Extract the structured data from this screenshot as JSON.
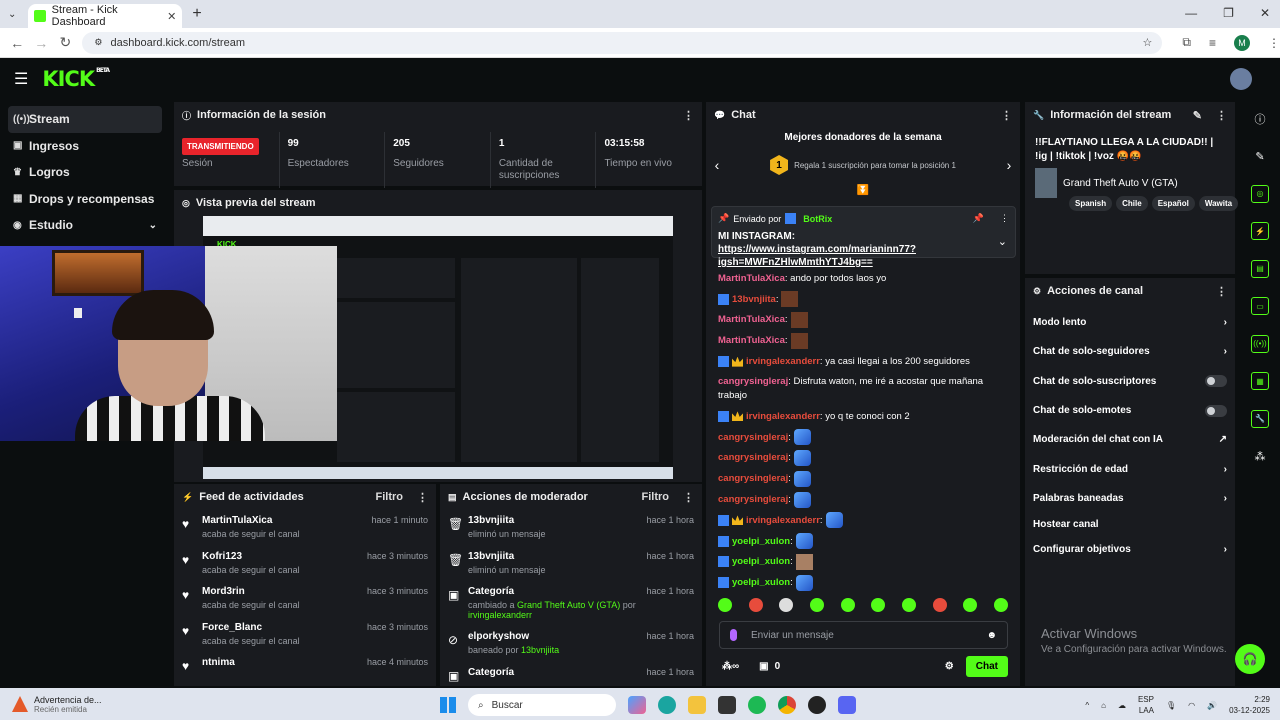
{
  "browser": {
    "tab_title": "Stream - Kick Dashboard",
    "url": "dashboard.kick.com/stream",
    "profile_initial": "M"
  },
  "brand": {
    "logo": "KICK",
    "beta": "BETA",
    "accent": "#53fc18"
  },
  "sidebar": {
    "items": [
      {
        "label": "Stream",
        "icon": "stream-icon"
      },
      {
        "label": "Ingresos",
        "icon": "wallet-icon"
      },
      {
        "label": "Logros",
        "icon": "trophy-icon"
      },
      {
        "label": "Drops y recompensas",
        "icon": "gift-icon"
      },
      {
        "label": "Estudio",
        "icon": "studio-icon"
      }
    ]
  },
  "session": {
    "title": "Información de la sesión",
    "status": "TRANSMITIENDO",
    "status_label": "Sesión",
    "viewers": "99",
    "viewers_label": "Espectadores",
    "followers": "205",
    "followers_label": "Seguidores",
    "subs": "1",
    "subs_label": "Cantidad de suscripciones",
    "live_time": "03:15:58",
    "live_time_label": "Tiempo en vivo"
  },
  "preview": {
    "title": "Vista previa del stream"
  },
  "activity": {
    "title": "Feed de actividades",
    "filter": "Filtro",
    "items": [
      {
        "name": "MartinTulaXica",
        "action": "acaba de seguir el canal",
        "time": "hace 1 minuto"
      },
      {
        "name": "Kofri123",
        "action": "acaba de seguir el canal",
        "time": "hace 3 minutos"
      },
      {
        "name": "Mord3rin",
        "action": "acaba de seguir el canal",
        "time": "hace 3 minutos"
      },
      {
        "name": "Force_Blanc",
        "action": "acaba de seguir el canal",
        "time": "hace 3 minutos"
      },
      {
        "name": "ntnima",
        "action": "",
        "time": "hace 4 minutos"
      }
    ]
  },
  "modactions": {
    "title": "Acciones de moderador",
    "filter": "Filtro",
    "items": [
      {
        "name": "13bvnjiita",
        "action": "eliminó un mensaje",
        "time": "hace 1 hora"
      },
      {
        "name": "13bvnjiita",
        "action": "eliminó un mensaje",
        "time": "hace 1 hora"
      },
      {
        "name": "Categoría",
        "action_pre": "cambiado a ",
        "action_hl": "Grand Theft Auto V (GTA)",
        "action_post": " por",
        "action_user": "irvingalexanderr",
        "time": "hace 1 hora"
      },
      {
        "name": "elporkyshow",
        "action_pre": "baneado por ",
        "action_hl": "13bvnjiita",
        "time": "hace 1 hora"
      },
      {
        "name": "Categoría",
        "time": "hace 1 hora"
      }
    ]
  },
  "chat": {
    "title": "Chat",
    "donors_title": "Mejores donadores de la semana",
    "donors_rank": "1",
    "donors_msg": "Regala 1 suscripción para tomar la posición 1",
    "pinned_by_label": "Enviado por",
    "pinned_by": "BotRix",
    "pinned_prefix": "MI INSTAGRAM: ",
    "pinned_link": "https://www.instagram.com/marianinn77?igsh=MWFnZHlwMmthYTJ4bg==",
    "messages": [
      {
        "user": "MartinTulaXica",
        "text": "ando por todos laos yo"
      },
      {
        "user": "13bvnjiita",
        "emote": "brown"
      },
      {
        "user": "MartinTulaXica",
        "emote": "brown"
      },
      {
        "user": "MartinTulaXica",
        "emote": "brown"
      },
      {
        "user": "irvingalexanderr",
        "text": "ya casi llegai a los 200 seguidores"
      },
      {
        "user": "cangrysingleraj",
        "text": "Disfruta waton, me iré a acostar que mañana trabajo"
      },
      {
        "user": "irvingalexanderr",
        "text": "yo q te conoci con 2"
      },
      {
        "user": "cangrysingleraj",
        "emote": "blue"
      },
      {
        "user": "cangrysingleraj",
        "emote": "blue"
      },
      {
        "user": "cangrysingleraj",
        "emote": "blue"
      },
      {
        "user": "cangrysingleraj",
        "emote": "blue"
      },
      {
        "user": "irvingalexanderr",
        "emote": "blue"
      },
      {
        "user": "yoelpi_xulon",
        "emote": "blue"
      },
      {
        "user": "yoelpi_xulon",
        "emote": "cat"
      },
      {
        "user": "yoelpi_xulon",
        "emote": "blue"
      }
    ],
    "input_placeholder": "Enviar un mensaje",
    "points": "0",
    "send": "Chat"
  },
  "streaminfo": {
    "title": "Información del stream",
    "stream_title": "!!FLAYTIANO LLEGA A LA CIUDAD!! | !ig | !tiktok | !voz 🤬🤬",
    "game": "Grand Theft Auto V (GTA)",
    "tags": [
      "Spanish",
      "Chile",
      "Español",
      "Wawita"
    ]
  },
  "channel": {
    "title": "Acciones de canal",
    "items": [
      {
        "label": "Modo lento",
        "control": "chevron"
      },
      {
        "label": "Chat de solo-seguidores",
        "control": "chevron"
      },
      {
        "label": "Chat de solo-suscriptores",
        "control": "toggle"
      },
      {
        "label": "Chat de solo-emotes",
        "control": "toggle"
      },
      {
        "label": "Moderación del chat con IA",
        "control": "external"
      },
      {
        "label": "Restricción de edad",
        "control": "chevron"
      },
      {
        "label": "Palabras baneadas",
        "control": "chevron"
      },
      {
        "label": "Hostear canal",
        "control": "none"
      },
      {
        "label": "Configurar objetivos",
        "control": "chevron"
      }
    ]
  },
  "watermark": {
    "line1": "Activar Windows",
    "line2": "Ve a Configuración para activar Windows."
  },
  "taskbar": {
    "notif_title": "Advertencia de...",
    "notif_sub": "Recién emitida",
    "search": "Buscar",
    "lang": "ESP",
    "lang2": "LAA",
    "time": "2:29",
    "date": "03-12-2025"
  }
}
